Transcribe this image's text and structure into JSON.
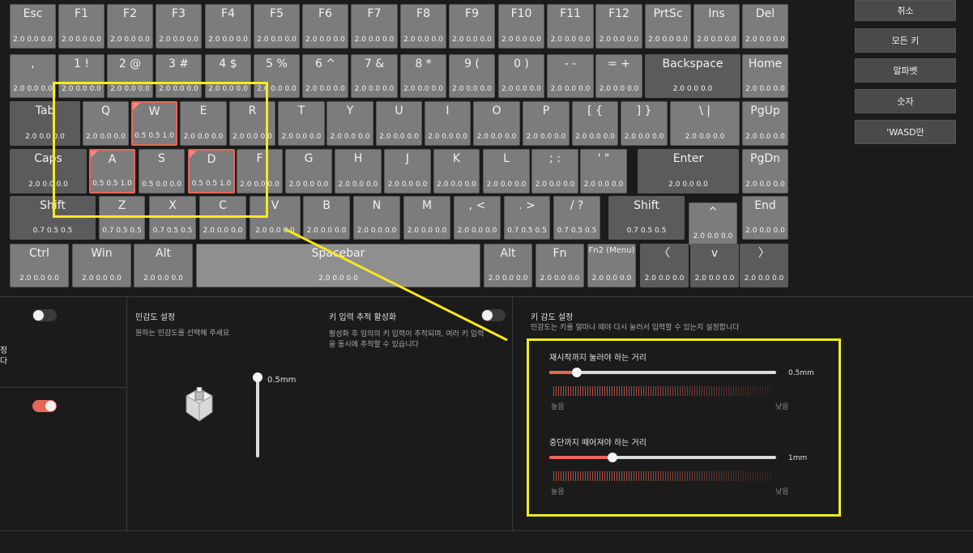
{
  "keyboard": {
    "rows": [
      [
        {
          "label": "Esc",
          "vals": "2.0  0.0  0.0"
        },
        {
          "label": "F1",
          "vals": "2.0  0.0  0.0"
        },
        {
          "label": "F2",
          "vals": "2.0  0.0  0.0"
        },
        {
          "label": "F3",
          "vals": "2.0  0.0  0.0"
        },
        {
          "label": "F4",
          "vals": "2.0  0.0  0.0"
        },
        {
          "label": "F5",
          "vals": "2.0  0.0  0.0"
        },
        {
          "label": "F6",
          "vals": "2.0  0.0  0.0"
        },
        {
          "label": "F7",
          "vals": "2.0  0.0  0.0"
        },
        {
          "label": "F8",
          "vals": "2.0  0.0  0.0"
        },
        {
          "label": "F9",
          "vals": "2.0  0.0  0.0"
        },
        {
          "label": "F10",
          "vals": "2.0  0.0  0.0"
        },
        {
          "label": "F11",
          "vals": "2.0  0.0  0.0"
        },
        {
          "label": "F12",
          "vals": "2.0  0.0  0.0"
        },
        {
          "label": "PrtSc",
          "vals": "2.0  0.0  0.0"
        },
        {
          "label": "Ins",
          "vals": "2.0  0.0  0.0"
        },
        {
          "label": "Del",
          "vals": "2.0  0.0  0.0"
        }
      ],
      [
        {
          "label": ",",
          "vals": "2.0  0.0  0.0"
        },
        {
          "label": "1 !",
          "vals": "2.0  0.0  0.0"
        },
        {
          "label": "2 @",
          "vals": "2.0  0.0  0.0"
        },
        {
          "label": "3 #",
          "vals": "2.0  0.0  0.0"
        },
        {
          "label": "4 $",
          "vals": "2.0  0.0  0.0"
        },
        {
          "label": "5 %",
          "vals": "2.0  0.0  0.0"
        },
        {
          "label": "6 ^",
          "vals": "2.0  0.0  0.0"
        },
        {
          "label": "7 &",
          "vals": "2.0  0.0  0.0"
        },
        {
          "label": "8 *",
          "vals": "2.0  0.0  0.0"
        },
        {
          "label": "9 (",
          "vals": "2.0  0.0  0.0"
        },
        {
          "label": "0 )",
          "vals": "2.0  0.0  0.0"
        },
        {
          "label": "- -",
          "vals": "2.0  0.0  0.0"
        },
        {
          "label": "= +",
          "vals": "2.0  0.0  0.0"
        },
        {
          "label": "Backspace",
          "vals": "2.0  0.0  0.0"
        },
        {
          "label": "Home",
          "vals": "2.0  0.0  0.0"
        }
      ],
      [
        {
          "label": "Tab",
          "vals": "2.0  0.0  0.0"
        },
        {
          "label": "Q",
          "vals": "2.0  0.0  0.0"
        },
        {
          "label": "W",
          "vals": "0.5  0.5  1.0",
          "selected": true
        },
        {
          "label": "E",
          "vals": "2.0  0.0  0.0"
        },
        {
          "label": "R",
          "vals": "2.0  0.0  0.0"
        },
        {
          "label": "T",
          "vals": "2.0  0.0  0.0"
        },
        {
          "label": "Y",
          "vals": "2.0  0.0  0.0"
        },
        {
          "label": "U",
          "vals": "2.0  0.0  0.0"
        },
        {
          "label": "I",
          "vals": "2.0  0.0  0.0"
        },
        {
          "label": "O",
          "vals": "2.0  0.0  0.0"
        },
        {
          "label": "P",
          "vals": "2.0  0.0  0.0"
        },
        {
          "label": "[ {",
          "vals": "2.0  0.0  0.0"
        },
        {
          "label": "] }",
          "vals": "2.0  0.0  0.0"
        },
        {
          "label": "\\ |",
          "vals": "2.0  0.0  0.0"
        },
        {
          "label": "PgUp",
          "vals": "2.0  0.0  0.0"
        }
      ],
      [
        {
          "label": "Caps",
          "vals": "2.0  0.0  0.0"
        },
        {
          "label": "A",
          "vals": "0.5  0.5  1.0",
          "selected": true
        },
        {
          "label": "S",
          "vals": "0.5  0.0  0.0"
        },
        {
          "label": "D",
          "vals": "0.5  0.5  1.0",
          "selected": true
        },
        {
          "label": "F",
          "vals": "2.0  0.0  0.0"
        },
        {
          "label": "G",
          "vals": "2.0  0.0  0.0"
        },
        {
          "label": "H",
          "vals": "2.0  0.0  0.0"
        },
        {
          "label": "J",
          "vals": "2.0  0.0  0.0"
        },
        {
          "label": "K",
          "vals": "2.0  0.0  0.0"
        },
        {
          "label": "L",
          "vals": "2.0  0.0  0.0"
        },
        {
          "label": "; :",
          "vals": "2.0  0.0  0.0"
        },
        {
          "label": "' \"",
          "vals": "2.0  0.0  0.0"
        },
        {
          "label": "Enter",
          "vals": "2.0  0.0  0.0"
        },
        {
          "label": "PgDn",
          "vals": "2.0  0.0  0.0"
        }
      ],
      [
        {
          "label": "Shift",
          "vals": "0.7  0.5  0.5"
        },
        {
          "label": "Z",
          "vals": "0.7  0.5  0.5"
        },
        {
          "label": "X",
          "vals": "0.7  0.5  0.5"
        },
        {
          "label": "C",
          "vals": "2.0  0.0  0.0"
        },
        {
          "label": "V",
          "vals": "2.0  0.0  0.0"
        },
        {
          "label": "B",
          "vals": "2.0  0.0  0.0"
        },
        {
          "label": "N",
          "vals": "2.0  0.0  0.0"
        },
        {
          "label": "M",
          "vals": "2.0  0.0  0.0"
        },
        {
          "label": ", <",
          "vals": "2.0  0.0  0.0"
        },
        {
          "label": ". >",
          "vals": "0.7  0.5  0.5"
        },
        {
          "label": "/ ?",
          "vals": "0.7  0.5  0.5"
        },
        {
          "label": "Shift",
          "vals": "0.7  0.5  0.5"
        },
        {
          "label": "^",
          "vals": "2.0  0.0  0.0"
        },
        {
          "label": "End",
          "vals": "2.0  0.0  0.0"
        }
      ],
      [
        {
          "label": "Ctrl",
          "vals": "2.0  0.0  0.0"
        },
        {
          "label": "Win",
          "vals": "2.0  0.0  0.0"
        },
        {
          "label": "Alt",
          "vals": "2.0  0.0  0.0"
        },
        {
          "label": "Spacebar",
          "vals": "2.0  0.0  0.0"
        },
        {
          "label": "Alt",
          "vals": "2.0  0.0  0.0"
        },
        {
          "label": "Fn",
          "vals": "2.0  0.0  0.0"
        },
        {
          "label": "Fn2 (Menu)",
          "vals": "2.0  0.0  0.0"
        },
        {
          "label": "〈",
          "vals": "2.0  0.0  0.0"
        },
        {
          "label": "v",
          "vals": "2.0  0.0  0.0"
        },
        {
          "label": "〉",
          "vals": "2.0  0.0  0.0"
        }
      ]
    ]
  },
  "side_buttons": [
    "취소",
    "모든 키",
    "알파벳",
    "숫자",
    "'WASD만"
  ],
  "left_panel": {
    "fragment_1": "정",
    "fragment_2": "다"
  },
  "sensitivity": {
    "title": "민감도 설정",
    "subtitle": "원하는 민감도를 선택해 주세요",
    "value_label": "0.5mm",
    "level": 0.0
  },
  "key_tracking": {
    "title": "키 입력 추적 활성화",
    "desc_line1": "활성화 후 임의의 키 입력이 추적되며, 여러 키 입력",
    "desc_line2": "을 동시에 추적할 수 있습니다",
    "enabled": false
  },
  "key_sensitivity": {
    "title": "키 감도 설정",
    "description": "민감도는 키를 얼마나 떼야 다시 눌러서 입력할 수 있는지 설정합니다",
    "reactivate": {
      "label": "재시작까지 눌러야 하는 거리",
      "value": "0.5mm",
      "level": 0.12,
      "low_label": "높음",
      "high_label": "낮음"
    },
    "release": {
      "label": "중단까지 떼어져야 하는 거리",
      "value": "1mm",
      "level": 0.28,
      "low_label": "높음",
      "high_label": "낮음"
    }
  },
  "toggles": {
    "top_left": false,
    "bottom_left": true
  },
  "colors": {
    "accent": "#e8665a",
    "highlight_box": "#f5ea1f",
    "background": "#1b1b1b"
  }
}
